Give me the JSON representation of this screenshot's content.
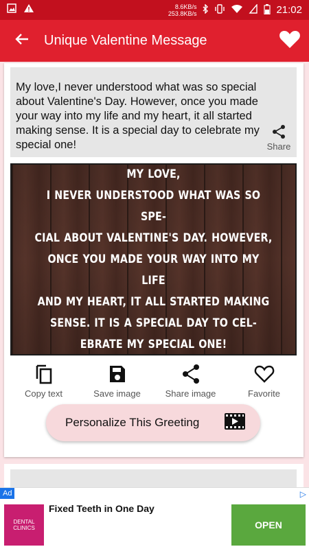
{
  "status_bar": {
    "net_down": "8.6KB/s",
    "net_up": "253.8KB/s",
    "time": "21:02"
  },
  "toolbar": {
    "title": "Unique Valentine Message",
    "back_icon": "arrow-left-icon",
    "favorite_icon": "heart-filled-icon"
  },
  "message": {
    "text": "My love,I never understood what was so special about Valentine's Day. However, once you made your way into my life and my heart, it all started making sense. It is a special day to celebrate my special one!",
    "share_label": "Share"
  },
  "image_card": {
    "lines": [
      "My love,",
      "I never understood what was so spe-",
      "cial about Valentine's Day. However,",
      "once you made your way into my life",
      "and my heart, it all started making",
      "sense. It is a special day to cel-",
      "ebrate my special one!"
    ]
  },
  "actions": [
    {
      "label": "Copy text",
      "icon": "copy-icon"
    },
    {
      "label": "Save image",
      "icon": "save-icon"
    },
    {
      "label": "Share image",
      "icon": "share-icon"
    },
    {
      "label": "Favorite",
      "icon": "heart-outline-icon"
    }
  ],
  "personalize": {
    "label": "Personalize This Greeting",
    "icon": "video-icon"
  },
  "ad": {
    "badge": "Ad",
    "title": "Fixed Teeth in One Day",
    "logo_text": "DENTAL CLINICS",
    "cta": "OPEN"
  },
  "colors": {
    "status_bar": "#c2101e",
    "toolbar": "#e0202e",
    "background": "#fbe3e6",
    "personalize_bg": "#f7d9dc",
    "ad_cta": "#5aa83e"
  }
}
